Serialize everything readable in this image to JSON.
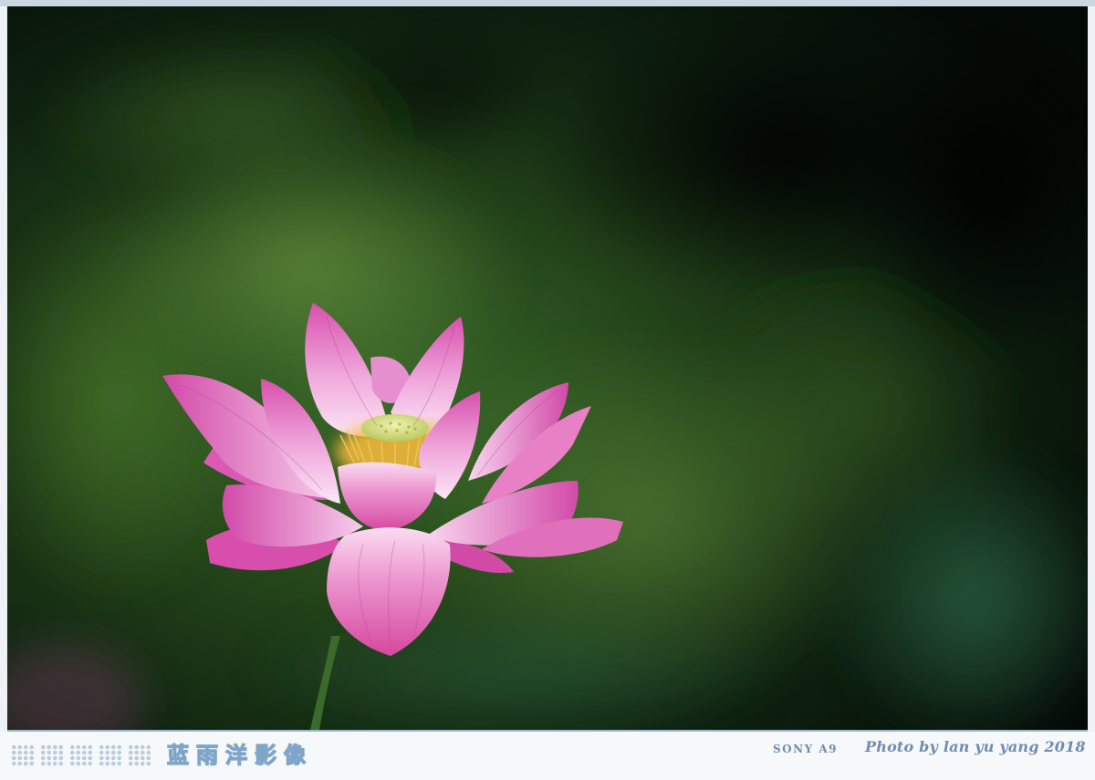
{
  "watermark": {
    "brand_text": "蓝雨洋影像",
    "camera_text": "SONY A9",
    "credit_text": "Photo by lan yu yang 2018"
  },
  "photo": {
    "subject": "pink-lotus-flower",
    "colors": {
      "background_dark": "#0a140c",
      "background_green": "#2e5a23",
      "petal_pink": "#e26bbf",
      "petal_light": "#f6d3ef",
      "seed_pod": "#d9e486",
      "stamens": "#f0b83a",
      "stem": "#3b6a2a"
    }
  },
  "footer": {
    "accent_color": "#7fa6c8",
    "dot_color": "#b9cddd"
  }
}
